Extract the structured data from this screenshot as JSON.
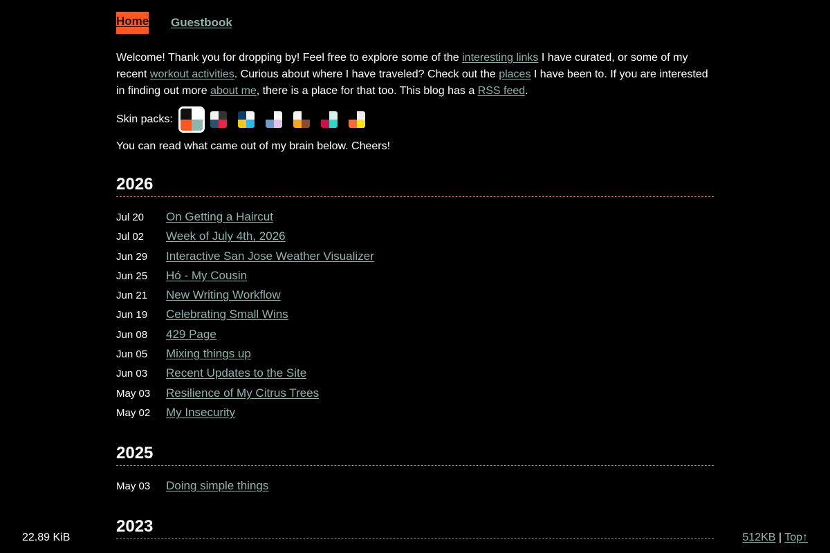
{
  "nav": {
    "home": "Home",
    "guestbook": "Guestbook"
  },
  "intro": {
    "t1": "Welcome! Thank you for dropping by! Feel free to explore some of the ",
    "link_interesting": "interesting links",
    "t2": " I have curated, or some of my recent ",
    "link_workout": "workout activities",
    "t3": ". Curious about where I have traveled? Check out the ",
    "link_places": "places",
    "t4": " I have been to. If you are interested in finding out more ",
    "link_about": "about me",
    "t5": ", there is a place for that too. This blog has a ",
    "link_rss": "RSS feed",
    "t6": "."
  },
  "skins": {
    "label": "Skin packs:",
    "packs": [
      {
        "colors": [
          "#111111",
          "#ffffff",
          "#ff5722",
          "#8fb3ad"
        ],
        "active": true
      },
      {
        "colors": [
          "#f2f2f2",
          "#333333",
          "#2f4f6f",
          "#e8264a"
        ],
        "active": false
      },
      {
        "colors": [
          "#0d3b66",
          "#f7f7f7",
          "#f5c518",
          "#2cb7e8"
        ],
        "active": false
      },
      {
        "colors": [
          "#000000",
          "#f7f7f7",
          "#6f9bc8",
          "#e0c3e8"
        ],
        "active": false
      },
      {
        "colors": [
          "#f7f7f7",
          "#000000",
          "#f5a623",
          "#8b4a2b"
        ],
        "active": false
      },
      {
        "colors": [
          "#000000",
          "#d7f0ee",
          "#d0104c",
          "#2ed6c8"
        ],
        "active": false
      },
      {
        "colors": [
          "#000000",
          "#eeeeee",
          "#ff6a3d",
          "#ffe21f"
        ],
        "active": false
      }
    ]
  },
  "outro": "You can read what came out of my brain below. Cheers!",
  "years": [
    {
      "year": "2026",
      "posts": [
        {
          "date": "Jul 20",
          "title": "On Getting a Haircut"
        },
        {
          "date": "Jul 02",
          "title": "Week of July 4th, 2026"
        },
        {
          "date": "Jun 29",
          "title": "Interactive San Jose Weather Visualizer"
        },
        {
          "date": "Jun 25",
          "title": "Hó - My Cousin"
        },
        {
          "date": "Jun 21",
          "title": "New Writing Workflow"
        },
        {
          "date": "Jun 19",
          "title": "Celebrating Small Wins"
        },
        {
          "date": "Jun 08",
          "title": "429 Page"
        },
        {
          "date": "Jun 05",
          "title": "Mixing things up"
        },
        {
          "date": "Jun 03",
          "title": "Recent Updates to the Site"
        },
        {
          "date": "May 03",
          "title": "Resilience of My Citrus Trees"
        },
        {
          "date": "May 02",
          "title": "My Insecurity"
        }
      ]
    },
    {
      "year": "2025",
      "posts": [
        {
          "date": "May 03",
          "title": "Doing simple things"
        }
      ]
    },
    {
      "year": "2023",
      "posts": []
    }
  ],
  "footer": {
    "size": "22.89 KiB",
    "badge": "512KB",
    "separator": " | ",
    "top": "Top↑"
  }
}
